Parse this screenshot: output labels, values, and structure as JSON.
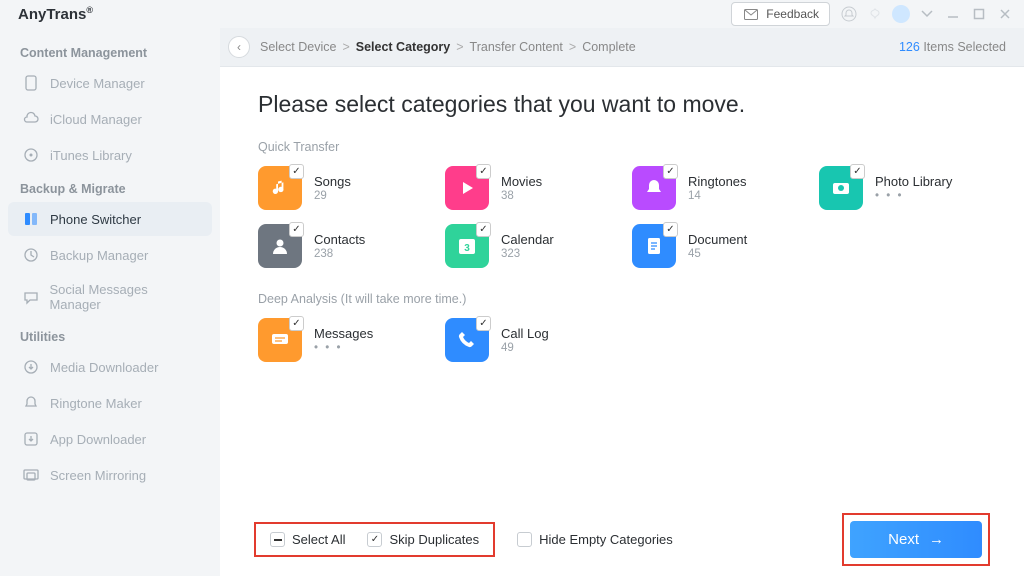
{
  "brand": "AnyTrans",
  "brand_sup": "®",
  "feedback_label": "Feedback",
  "sidebar": {
    "sections": [
      {
        "heading": "Content Management",
        "items": [
          {
            "key": "device_manager",
            "label": "Device Manager"
          },
          {
            "key": "icloud_manager",
            "label": "iCloud Manager"
          },
          {
            "key": "itunes_library",
            "label": "iTunes Library"
          }
        ]
      },
      {
        "heading": "Backup & Migrate",
        "items": [
          {
            "key": "phone_switcher",
            "label": "Phone Switcher",
            "active": true
          },
          {
            "key": "backup_manager",
            "label": "Backup Manager"
          },
          {
            "key": "social_messages_manager",
            "label": "Social Messages Manager"
          }
        ]
      },
      {
        "heading": "Utilities",
        "items": [
          {
            "key": "media_downloader",
            "label": "Media Downloader"
          },
          {
            "key": "ringtone_maker",
            "label": "Ringtone Maker"
          },
          {
            "key": "app_downloader",
            "label": "App Downloader"
          },
          {
            "key": "screen_mirroring",
            "label": "Screen Mirroring"
          }
        ]
      }
    ]
  },
  "breadcrumb": [
    "Select Device",
    "Select Category",
    "Transfer Content",
    "Complete"
  ],
  "breadcrumb_active_index": 1,
  "items_selected_count": "126",
  "items_selected_label": "Items Selected",
  "page_title": "Please select categories that you want to move.",
  "quick_label": "Quick Transfer",
  "quick": [
    {
      "name": "Songs",
      "count": "29",
      "color": "#ff9a2e",
      "icon": "music",
      "checked": true
    },
    {
      "name": "Movies",
      "count": "38",
      "color": "#ff3d8b",
      "icon": "play",
      "checked": true
    },
    {
      "name": "Ringtones",
      "count": "14",
      "color": "#b94bff",
      "icon": "bell",
      "checked": true
    },
    {
      "name": "Photo Library",
      "count": "• • •",
      "color": "#18c6b0",
      "icon": "camera",
      "checked": true,
      "dots": true
    },
    {
      "name": "Contacts",
      "count": "238",
      "color": "#6e7680",
      "icon": "person",
      "checked": true
    },
    {
      "name": "Calendar",
      "count": "323",
      "color": "#2fd39a",
      "icon": "cal",
      "checked": true
    },
    {
      "name": "Document",
      "count": "45",
      "color": "#2f8cff",
      "icon": "doc",
      "checked": true
    }
  ],
  "deep_label": "Deep Analysis (It will take more time.)",
  "deep": [
    {
      "name": "Messages",
      "count": "• • •",
      "color": "#ff9a2e",
      "icon": "msg",
      "checked": true,
      "dots": true
    },
    {
      "name": "Call Log",
      "count": "49",
      "color": "#2f8cff",
      "icon": "phone",
      "checked": true
    }
  ],
  "footer": {
    "select_all": "Select All",
    "skip_duplicates": "Skip Duplicates",
    "hide_empty": "Hide Empty Categories",
    "next": "Next"
  }
}
